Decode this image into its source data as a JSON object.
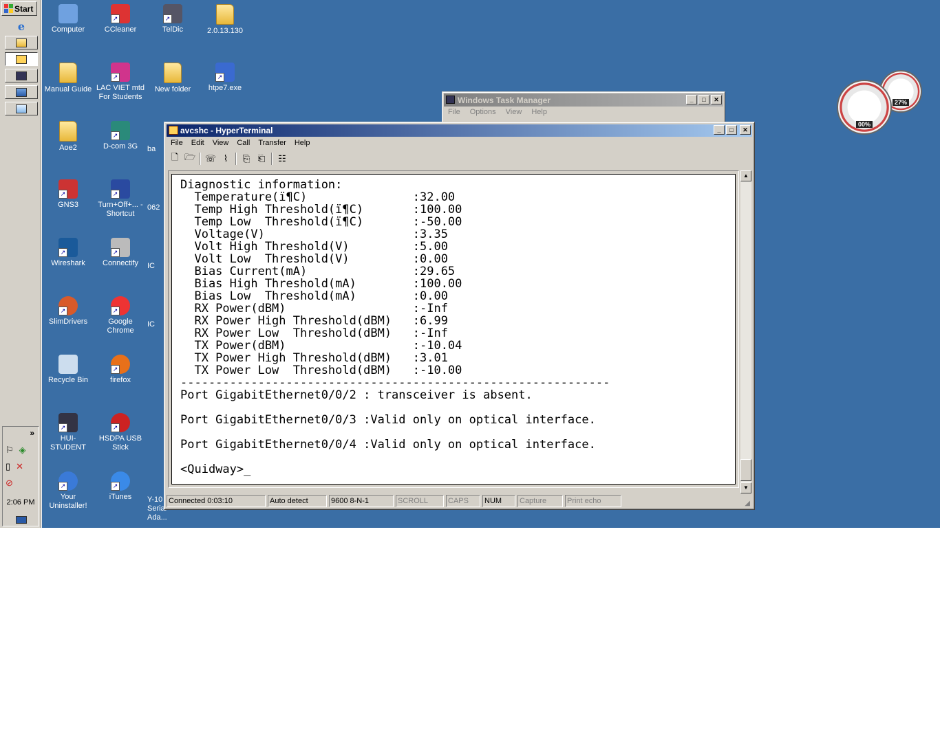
{
  "taskbar": {
    "start_label": "Start",
    "clock": "2:06 PM",
    "tray_chevron": "»"
  },
  "desktop_icons": [
    {
      "label": "Computer",
      "icon": "computer-icon"
    },
    {
      "label": "CCleaner",
      "icon": "ccleaner-icon"
    },
    {
      "label": "TelDic",
      "icon": "teldic-icon"
    },
    {
      "label": "2.0.13.130",
      "icon": "folder-icon"
    },
    {
      "label": "Manual Guide",
      "icon": "folder-icon"
    },
    {
      "label": "LAC VIET mtd For Students",
      "icon": "lacviet-icon"
    },
    {
      "label": "New folder",
      "icon": "folder-icon"
    },
    {
      "label": "htpe7.exe",
      "icon": "exe-icon"
    },
    {
      "label": "Aoe2",
      "icon": "folder-icon"
    },
    {
      "label": "D-com 3G",
      "icon": "dcom-icon"
    },
    {
      "label": "ba",
      "icon": "partial-icon"
    },
    {
      "label": "GNS3",
      "icon": "gns3-icon"
    },
    {
      "label": "Turn+Off+... - Shortcut",
      "icon": "shortcut-icon"
    },
    {
      "label": "062",
      "icon": "partial-icon"
    },
    {
      "label": "Wireshark",
      "icon": "wireshark-icon"
    },
    {
      "label": "Connectify",
      "icon": "connectify-icon"
    },
    {
      "label": "IC",
      "icon": "partial-icon"
    },
    {
      "label": "SlimDrivers",
      "icon": "slimdrivers-icon"
    },
    {
      "label": "Google Chrome",
      "icon": "chrome-icon"
    },
    {
      "label": "IC",
      "icon": "partial-icon"
    },
    {
      "label": "Recycle Bin",
      "icon": "recycle-bin-icon"
    },
    {
      "label": "firefox",
      "icon": "firefox-icon"
    },
    {
      "label": "HUI-STUDENT",
      "icon": "student-icon"
    },
    {
      "label": "HSDPA USB Stick",
      "icon": "hsdpa-icon"
    },
    {
      "label": "Your Uninstaller!",
      "icon": "uninstaller-icon"
    },
    {
      "label": "iTunes",
      "icon": "itunes-icon"
    },
    {
      "label": "Y-10 Serial Ada...",
      "icon": "partial-icon"
    }
  ],
  "taskmgr": {
    "title": "Windows Task Manager",
    "menu": [
      "File",
      "Options",
      "View",
      "Help"
    ]
  },
  "hyperterminal": {
    "title": "avcshc - HyperTerminal",
    "menu": [
      "File",
      "Edit",
      "View",
      "Call",
      "Transfer",
      "Help"
    ],
    "terminal_lines": [
      "Diagnostic information:",
      "  Temperature(ï¶C)               :32.00",
      "  Temp High Threshold(ï¶C)       :100.00",
      "  Temp Low  Threshold(ï¶C)       :-50.00",
      "  Voltage(V)                     :3.35",
      "  Volt High Threshold(V)         :5.00",
      "  Volt Low  Threshold(V)         :0.00",
      "  Bias Current(mA)               :29.65",
      "  Bias High Threshold(mA)        :100.00",
      "  Bias Low  Threshold(mA)        :0.00",
      "  RX Power(dBM)                  :-Inf",
      "  RX Power High Threshold(dBM)   :6.99",
      "  RX Power Low  Threshold(dBM)   :-Inf",
      "  TX Power(dBM)                  :-10.04",
      "  TX Power High Threshold(dBM)   :3.01",
      "  TX Power Low  Threshold(dBM)   :-10.00",
      "-------------------------------------------------------------",
      "Port GigabitEthernet0/0/2 : transceiver is absent.",
      "",
      "Port GigabitEthernet0/0/3 :Valid only on optical interface.",
      "",
      "Port GigabitEthernet0/0/4 :Valid only on optical interface.",
      "",
      "<Quidway>_"
    ],
    "status": {
      "connected": "Connected 0:03:10",
      "detect": "Auto detect",
      "settings": "9600 8-N-1",
      "scroll": "SCROLL",
      "caps": "CAPS",
      "num": "NUM",
      "capture": "Capture",
      "print_echo": "Print echo"
    }
  },
  "gadget": {
    "cpu_pct": "00%",
    "mem_pct": "27%"
  }
}
